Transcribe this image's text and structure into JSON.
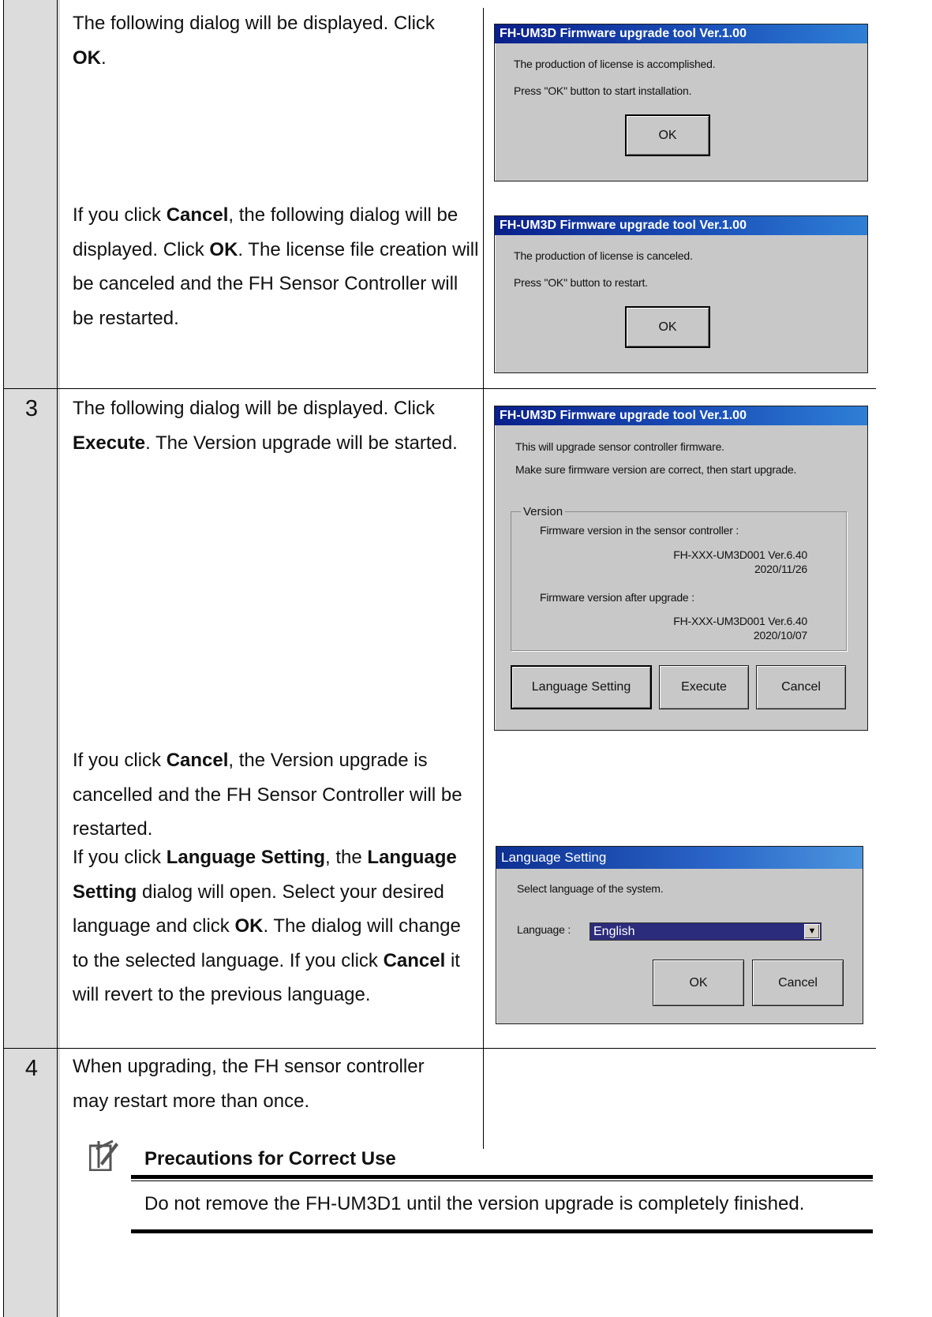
{
  "steps": {
    "s2": {
      "para1": {
        "pre": "The following dialog will be displayed. Click",
        "b1": "OK",
        "post": "."
      },
      "para2": {
        "pre": "If you click ",
        "b1": "Cancel",
        "mid1": ", the following dialog will be displayed. Click ",
        "b2": "OK",
        "post": ". The license file creation will be canceled and the FH Sensor Controller will be restarted."
      }
    },
    "s3": {
      "number": "3",
      "para1": {
        "pre": "The following dialog will be displayed. Click ",
        "b1": "Execute",
        "post": ". The Version upgrade will be started."
      },
      "para2": {
        "pre": "If you click ",
        "b1": "Cancel",
        "post": ", the Version upgrade is cancelled and the FH Sensor Controller will be restarted."
      },
      "para3": {
        "pre": "If you click ",
        "b1": "Language Setting",
        "mid1": ", the ",
        "b2": "Language Setting",
        "mid2": " dialog will open. Select your desired language and click ",
        "b3": "OK",
        "mid3": ". The dialog will change to the selected language. If you click ",
        "b4": "Cancel",
        "post": " it will revert to the previous language."
      }
    },
    "s4": {
      "number": "4",
      "para1": "When upgrading, the FH sensor controller may restart more than once."
    }
  },
  "dialogs": {
    "license_ok": {
      "title": "FH-UM3D Firmware upgrade tool Ver.1.00",
      "line1": "The production of license is accomplished.",
      "line2": "Press \"OK\" button to start installation.",
      "ok": "OK"
    },
    "license_cancel": {
      "title": "FH-UM3D Firmware upgrade tool Ver.1.00",
      "line1": "The production of license is canceled.",
      "line2": "Press \"OK\" button to restart.",
      "ok": "OK"
    },
    "upgrade": {
      "title": "FH-UM3D Firmware upgrade tool Ver.1.00",
      "line1": "This will upgrade sensor controller firmware.",
      "line2": "Make sure firmware version are correct, then start upgrade.",
      "group_label": "Version",
      "current_label": "Firmware version in the sensor controller :",
      "current_version": "FH-XXX-UM3D001 Ver.6.40",
      "current_date": "2020/11/26",
      "after_label": "Firmware version after upgrade :",
      "after_version": "FH-XXX-UM3D001 Ver.6.40",
      "after_date": "2020/10/07",
      "btn_language": "Language Setting",
      "btn_execute": "Execute",
      "btn_cancel": "Cancel"
    },
    "language": {
      "title": "Language Setting",
      "line1": "Select language of the system.",
      "language_label": "Language :",
      "language_value": "English",
      "ok": "OK",
      "cancel": "Cancel"
    }
  },
  "precautions": {
    "title": "Precautions for Correct Use",
    "body": "Do not remove the FH-UM3D1 until the version upgrade is completely finished."
  },
  "colors": {
    "step_column": "#dcdcdc",
    "dialog_face": "#c8c8c8",
    "title_bar": "#0a1f8a"
  }
}
